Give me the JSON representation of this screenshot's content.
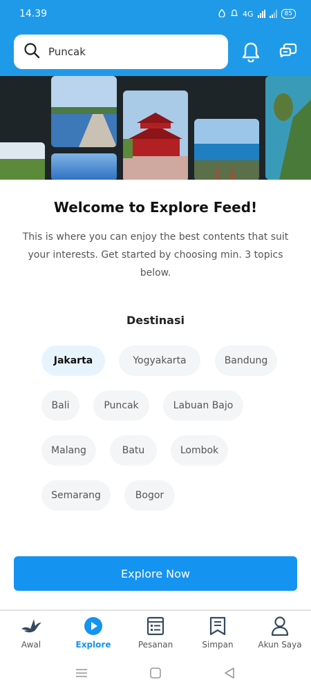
{
  "status_bar": {
    "time": "14.39",
    "network": "4G",
    "battery": "85"
  },
  "header": {
    "search": {
      "value": "Puncak",
      "icon": "search-icon"
    },
    "notification_icon": "bell-icon",
    "chat_icon": "chat-icon"
  },
  "welcome": {
    "title": "Welcome to Explore Feed!",
    "text": "This is where you can enjoy the best contents that suit your interests. Get started by choosing min. 3 topics below."
  },
  "topics": {
    "title": "Destinasi",
    "chips": [
      {
        "label": "Jakarta",
        "selected": true
      },
      {
        "label": "Yogyakarta",
        "selected": false
      },
      {
        "label": "Bandung",
        "selected": false
      },
      {
        "label": "Bali",
        "selected": false
      },
      {
        "label": "Puncak",
        "selected": false
      },
      {
        "label": "Labuan Bajo",
        "selected": false
      },
      {
        "label": "Malang",
        "selected": false
      },
      {
        "label": "Batu",
        "selected": false
      },
      {
        "label": "Lombok",
        "selected": false
      },
      {
        "label": "Semarang",
        "selected": false
      },
      {
        "label": "Bogor",
        "selected": false
      }
    ]
  },
  "explore_button": {
    "label": "Explore Now"
  },
  "bottom_nav": {
    "items": [
      {
        "label": "Awal",
        "icon": "bird-logo-icon",
        "active": false
      },
      {
        "label": "Explore",
        "icon": "play-circle-icon",
        "active": true
      },
      {
        "label": "Pesanan",
        "icon": "orders-list-icon",
        "active": false
      },
      {
        "label": "Simpan",
        "icon": "bookmark-icon",
        "active": false
      },
      {
        "label": "Akun Saya",
        "icon": "user-icon",
        "active": false
      }
    ]
  },
  "colors": {
    "brand_blue": "#1f9ae8",
    "button_blue": "#1593f0",
    "chip_bg": "#f3f5f7",
    "chip_selected_bg": "#e8f4fd"
  }
}
